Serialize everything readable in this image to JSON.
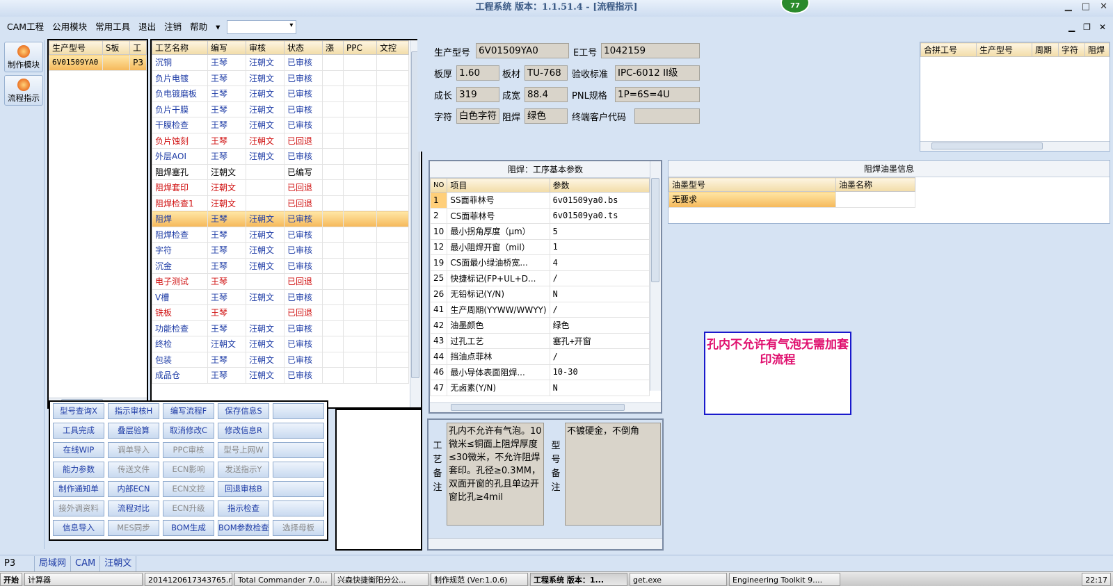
{
  "window": {
    "title": "工程系统   版本：1.1.51.4 - [流程指示]",
    "badge": "77"
  },
  "menu": {
    "items": [
      "CAM工程",
      "公用模块",
      "常用工具",
      "退出",
      "注销",
      "帮助"
    ],
    "dropdown_arrow": "▾"
  },
  "window_controls": {
    "min": "▁",
    "max": "□",
    "close": "✕"
  },
  "mdi_controls": {
    "min": "▁",
    "max": "❐",
    "close": "✕"
  },
  "leftnav": {
    "items": [
      "制作模块",
      "流程指示"
    ]
  },
  "model_list": {
    "headers": [
      "生产型号",
      "S板",
      "工"
    ],
    "rows": [
      [
        "6V01509YA0",
        "",
        "P3"
      ]
    ]
  },
  "process": {
    "headers": [
      "工艺名称",
      "编写",
      "审核",
      "状态",
      "漲",
      "PPC",
      "文控"
    ],
    "rows": [
      {
        "name": "沉铜",
        "writer": "王琴",
        "reviewer": "汪朝文",
        "status": "已审核",
        "red": false
      },
      {
        "name": "负片电镀",
        "writer": "王琴",
        "reviewer": "汪朝文",
        "status": "已审核",
        "red": false
      },
      {
        "name": "负电镀磨板",
        "writer": "王琴",
        "reviewer": "汪朝文",
        "status": "已审核",
        "red": false
      },
      {
        "name": "负片干膜",
        "writer": "王琴",
        "reviewer": "汪朝文",
        "status": "已审核",
        "red": false
      },
      {
        "name": "干膜检查",
        "writer": "王琴",
        "reviewer": "汪朝文",
        "status": "已审核",
        "red": false
      },
      {
        "name": "负片蚀刻",
        "writer": "王琴",
        "reviewer": "汪朝文",
        "status": "已回退",
        "red": true
      },
      {
        "name": "外层AOI",
        "writer": "王琴",
        "reviewer": "汪朝文",
        "status": "已审核",
        "red": false
      },
      {
        "name": "阻焊塞孔",
        "writer": "汪朝文",
        "reviewer": "",
        "status": "已编写",
        "red": false,
        "black": true
      },
      {
        "name": "阻焊套印",
        "writer": "汪朝文",
        "reviewer": "",
        "status": "已回退",
        "red": true
      },
      {
        "name": "阻焊检查1",
        "writer": "汪朝文",
        "reviewer": "",
        "status": "已回退",
        "red": true
      },
      {
        "name": "阻焊",
        "writer": "王琴",
        "reviewer": "汪朝文",
        "status": "已审核",
        "red": false,
        "selected": true
      },
      {
        "name": "阻焊检查",
        "writer": "王琴",
        "reviewer": "汪朝文",
        "status": "已审核",
        "red": false
      },
      {
        "name": "字符",
        "writer": "王琴",
        "reviewer": "汪朝文",
        "status": "已审核",
        "red": false
      },
      {
        "name": "沉金",
        "writer": "王琴",
        "reviewer": "汪朝文",
        "status": "已审核",
        "red": false
      },
      {
        "name": "电子测试",
        "writer": "王琴",
        "reviewer": "",
        "status": "已回退",
        "red": true
      },
      {
        "name": "V槽",
        "writer": "王琴",
        "reviewer": "汪朝文",
        "status": "已审核",
        "red": false
      },
      {
        "name": "铣板",
        "writer": "王琴",
        "reviewer": "",
        "status": "已回退",
        "red": true
      },
      {
        "name": "功能检查",
        "writer": "王琴",
        "reviewer": "汪朝文",
        "status": "已审核",
        "red": false
      },
      {
        "name": "终检",
        "writer": "汪朝文",
        "reviewer": "汪朝文",
        "status": "已审核",
        "red": false
      },
      {
        "name": "包装",
        "writer": "王琴",
        "reviewer": "汪朝文",
        "status": "已审核",
        "red": false
      },
      {
        "name": "成品仓",
        "writer": "王琴",
        "reviewer": "汪朝文",
        "status": "已审核",
        "red": false
      }
    ]
  },
  "buttons": [
    [
      {
        "t": "型号查询X"
      },
      {
        "t": "指示审核H"
      },
      {
        "t": "编写流程F"
      },
      {
        "t": "保存信息S"
      },
      {
        "t": "",
        "blank": true
      }
    ],
    [
      {
        "t": "工具完成"
      },
      {
        "t": "叠层验算"
      },
      {
        "t": "取消修改C"
      },
      {
        "t": "修改信息R"
      },
      {
        "t": "",
        "blank": true
      }
    ],
    [
      {
        "t": "在线WIP"
      },
      {
        "t": "调单导入",
        "dis": true
      },
      {
        "t": "PPC审核",
        "dis": true
      },
      {
        "t": "型号上网W",
        "dis": true
      },
      {
        "t": "",
        "blank": true
      }
    ],
    [
      {
        "t": "能力参数"
      },
      {
        "t": "传送文件",
        "dis": true
      },
      {
        "t": "ECN影响",
        "dis": true
      },
      {
        "t": "发送指示Y",
        "dis": true
      },
      {
        "t": "",
        "blank": true
      }
    ],
    [
      {
        "t": "制作通知单"
      },
      {
        "t": "内部ECN"
      },
      {
        "t": "ECN文控",
        "dis": true
      },
      {
        "t": "回退审核B"
      },
      {
        "t": "",
        "blank": true
      }
    ],
    [
      {
        "t": "接外调资料",
        "dis": true
      },
      {
        "t": "流程对比"
      },
      {
        "t": "ECN升级",
        "dis": true
      },
      {
        "t": "指示检查"
      },
      {
        "t": "",
        "blank": true
      }
    ],
    [
      {
        "t": "信息导入"
      },
      {
        "t": "MES同步",
        "dis": true
      },
      {
        "t": "BOM生成"
      },
      {
        "t": "BOM参数检查"
      },
      {
        "t": "选择母板",
        "dis": true
      }
    ]
  ],
  "info": {
    "prod_model_label": "生产型号",
    "prod_model": "6V01509YA0",
    "e_no_label": "E工号",
    "e_no": "1042159",
    "thickness_label": "板厚",
    "thickness": "1.60",
    "material_label": "板材",
    "material": "TU-768",
    "standard_label": "验收标准",
    "standard": "IPC-6012 II级",
    "length_label": "成长",
    "length": "319",
    "width_label": "成宽",
    "width": "88.4",
    "pnl_label": "PNL规格",
    "pnl": "1P=6S=4U",
    "char_label": "字符",
    "char": "白色字符",
    "mask_label": "阻焊",
    "mask": "绿色",
    "client_label": "终端客户代码",
    "client": ""
  },
  "merge": {
    "headers": [
      "合拼工号",
      "生产型号",
      "周期",
      "字符",
      "阻焊"
    ]
  },
  "params": {
    "title": "阻焊：工序基本参数",
    "headers": [
      "NO",
      "项目",
      "参数"
    ],
    "rows": [
      [
        "1",
        "SS面菲林号",
        "6v01509ya0.bs"
      ],
      [
        "2",
        "CS面菲林号",
        "6v01509ya0.ts"
      ],
      [
        "10",
        "最小拐角厚度（μm）",
        "5"
      ],
      [
        "12",
        "最小阻焊开窗（mil）",
        "1"
      ],
      [
        "19",
        "CS面最小绿油桥宽...",
        "4"
      ],
      [
        "25",
        "快捷标记(FP+UL+D...",
        "/"
      ],
      [
        "26",
        "无铅标记(Y/N)",
        "N"
      ],
      [
        "41",
        "生产周期(YYWW/WWYY)",
        "/"
      ],
      [
        "42",
        "油墨颜色",
        "绿色"
      ],
      [
        "43",
        "过孔工艺",
        "塞孔+开窗"
      ],
      [
        "44",
        "挡油点菲林",
        "/"
      ],
      [
        "46",
        "最小导体表面阻焊...",
        "10-30"
      ],
      [
        "47",
        "无卤素(Y/N)",
        "N"
      ]
    ]
  },
  "ink": {
    "title": "阻焊油墨信息",
    "headers": [
      "油墨型号",
      "油墨名称"
    ],
    "rows": [
      [
        "无要求",
        ""
      ]
    ]
  },
  "remarks": {
    "process_label": "工艺备注",
    "process_text": "孔内不允许有气泡。10微米≤铜面上阻焊厚度≤30微米，不允许阻焊套印。孔径≥0.3MM，双面开窗的孔且单边开窗比孔≥4mil",
    "model_label": "型号备注",
    "model_text": "不镀硬金，不倒角"
  },
  "callout": "孔内不允许有气泡无需加套印流程",
  "statusbar": {
    "items": [
      "P3",
      "局域网",
      "CAM",
      "汪朝文"
    ]
  },
  "taskbar": {
    "start": "开始",
    "items": [
      "计算器",
      "20141206173437​65.r...",
      "Total Commander 7.0...",
      "兴森快捷衡阳分公...",
      "制作规范 (Ver:1.0.6)",
      "工程系统   版本：1...",
      "get.exe",
      "Engineering Toolkit 9...."
    ],
    "clock": "22:17"
  }
}
